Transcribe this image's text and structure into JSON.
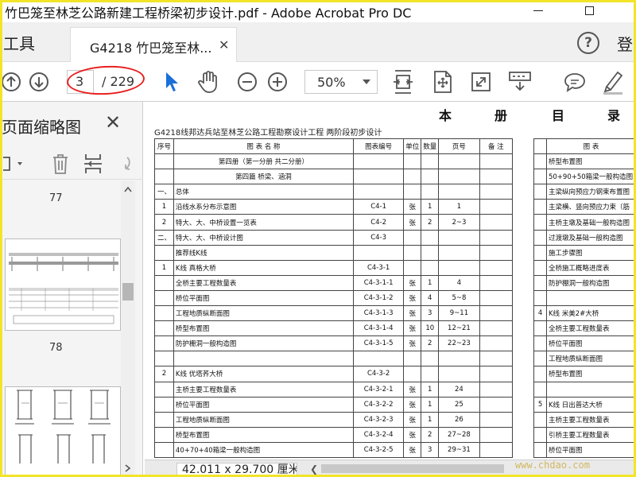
{
  "window": {
    "title": "竹巴笼至林芝公路新建工程桥梁初步设计.pdf - Adobe Acrobat Pro DC"
  },
  "tabs": {
    "tools_label": "工具",
    "document_tab_label": "G4218 竹巴笼至林...",
    "signin_label": "登"
  },
  "toolbar": {
    "current_page": "3",
    "total_pages": "/ 229",
    "zoom": "50%",
    "icons": [
      "prev-page-icon",
      "next-page-icon",
      "select-cursor-icon",
      "hand-icon",
      "zoom-out-icon",
      "zoom-in-icon",
      "fit-page-icon",
      "rotate-icon",
      "full-screen-icon",
      "scroll-mode-icon",
      "comment-icon",
      "highlight-pen-icon"
    ],
    "annotation_color": "#e82020"
  },
  "left_pane": {
    "title": "页面缩略图",
    "thumb_labels": [
      "77",
      "78"
    ]
  },
  "document": {
    "header_chars": [
      "本",
      "册",
      "目",
      "录"
    ],
    "subtitle": "G4218线邦达兵站至林芝公路工程勘察设计工程 两阶段初步设计",
    "columns": [
      "序号",
      "图 表 名 称",
      "图表编号",
      "单位",
      "数量",
      "页号",
      "备 注"
    ],
    "right_column_header": "图 表",
    "rows": [
      {
        "no": "",
        "name": "第四册（第一分册 共二分册）",
        "code": "",
        "unit": "",
        "qty": "",
        "page": "",
        "note": "",
        "center": true
      },
      {
        "no": "",
        "name": "第四篇 桥梁、涵洞",
        "code": "",
        "unit": "",
        "qty": "",
        "page": "",
        "note": "",
        "center": true
      },
      {
        "no": "一、",
        "name": "总体",
        "code": "",
        "unit": "",
        "qty": "",
        "page": "",
        "note": ""
      },
      {
        "no": "1",
        "name": "沿线水系分布示意图",
        "code": "C4-1",
        "unit": "张",
        "qty": "1",
        "page": "1",
        "note": ""
      },
      {
        "no": "2",
        "name": "特大、大、中桥设置一览表",
        "code": "C4-2",
        "unit": "张",
        "qty": "2",
        "page": "2~3",
        "note": ""
      },
      {
        "no": "二、",
        "name": "特大、大、中桥设计图",
        "code": "C4-3",
        "unit": "",
        "qty": "",
        "page": "",
        "note": ""
      },
      {
        "no": "",
        "name": "推荐线K线",
        "code": "",
        "unit": "",
        "qty": "",
        "page": "",
        "note": ""
      },
      {
        "no": "1",
        "name": "K线 真格大桥",
        "code": "C4-3-1",
        "unit": "",
        "qty": "",
        "page": "",
        "note": ""
      },
      {
        "no": "",
        "name": "全桥主要工程数量表",
        "code": "C4-3-1-1",
        "unit": "张",
        "qty": "1",
        "page": "4",
        "note": ""
      },
      {
        "no": "",
        "name": "桥位平面图",
        "code": "C4-3-1-2",
        "unit": "张",
        "qty": "4",
        "page": "5~8",
        "note": ""
      },
      {
        "no": "",
        "name": "工程地质纵断面图",
        "code": "C4-3-1-3",
        "unit": "张",
        "qty": "3",
        "page": "9~11",
        "note": ""
      },
      {
        "no": "",
        "name": "桥型布置图",
        "code": "C4-3-1-4",
        "unit": "张",
        "qty": "10",
        "page": "12~21",
        "note": ""
      },
      {
        "no": "",
        "name": "防护栅洞一般构造图",
        "code": "C4-3-1-5",
        "unit": "张",
        "qty": "2",
        "page": "22~23",
        "note": ""
      },
      {
        "no": "",
        "name": "",
        "code": "",
        "unit": "",
        "qty": "",
        "page": "",
        "note": ""
      },
      {
        "no": "2",
        "name": "K线 优塔荞大桥",
        "code": "C4-3-2",
        "unit": "",
        "qty": "",
        "page": "",
        "note": ""
      },
      {
        "no": "",
        "name": "主桥主要工程数量表",
        "code": "C4-3-2-1",
        "unit": "张",
        "qty": "1",
        "page": "24",
        "note": ""
      },
      {
        "no": "",
        "name": "桥位平面图",
        "code": "C4-3-2-2",
        "unit": "张",
        "qty": "1",
        "page": "25",
        "note": ""
      },
      {
        "no": "",
        "name": "工程地质纵断面图",
        "code": "C4-3-2-3",
        "unit": "张",
        "qty": "1",
        "page": "26",
        "note": ""
      },
      {
        "no": "",
        "name": "桥型布置图",
        "code": "C4-3-2-4",
        "unit": "张",
        "qty": "2",
        "page": "27~28",
        "note": ""
      },
      {
        "no": "",
        "name": "40+70+40箱梁一般构造图",
        "code": "C4-3-2-5",
        "unit": "张",
        "qty": "3",
        "page": "29~31",
        "note": ""
      }
    ],
    "right_rows": [
      {
        "no": "",
        "name": "桥型布置图"
      },
      {
        "no": "",
        "name": "50+90+50箱梁一般构造图"
      },
      {
        "no": "",
        "name": "主梁纵向预应力钢束布置图"
      },
      {
        "no": "",
        "name": "主梁横、竖向预应力束（筋"
      },
      {
        "no": "",
        "name": "主桥主墩及基础一般构造图"
      },
      {
        "no": "",
        "name": "过渡墩及基础一般构造图"
      },
      {
        "no": "",
        "name": "施工步骤图"
      },
      {
        "no": "",
        "name": "全桥施工概略进度表"
      },
      {
        "no": "",
        "name": "防护棚洞一般构造图"
      },
      {
        "no": "",
        "name": ""
      },
      {
        "no": "4",
        "name": "K线 米美2#大桥"
      },
      {
        "no": "",
        "name": "全桥主要工程数量表"
      },
      {
        "no": "",
        "name": "桥位平面图"
      },
      {
        "no": "",
        "name": "工程地质纵断面图"
      },
      {
        "no": "",
        "name": "桥型布置图"
      },
      {
        "no": "",
        "name": ""
      },
      {
        "no": "5",
        "name": "K线 日出普达大桥"
      },
      {
        "no": "",
        "name": "主桥主要工程数量表"
      },
      {
        "no": "",
        "name": "引桥主要工程数量表"
      },
      {
        "no": "",
        "name": "桥位平面图"
      }
    ]
  },
  "status": {
    "page_size": "42.011 x 29.700 厘米"
  },
  "watermark": "www.chdao.com"
}
